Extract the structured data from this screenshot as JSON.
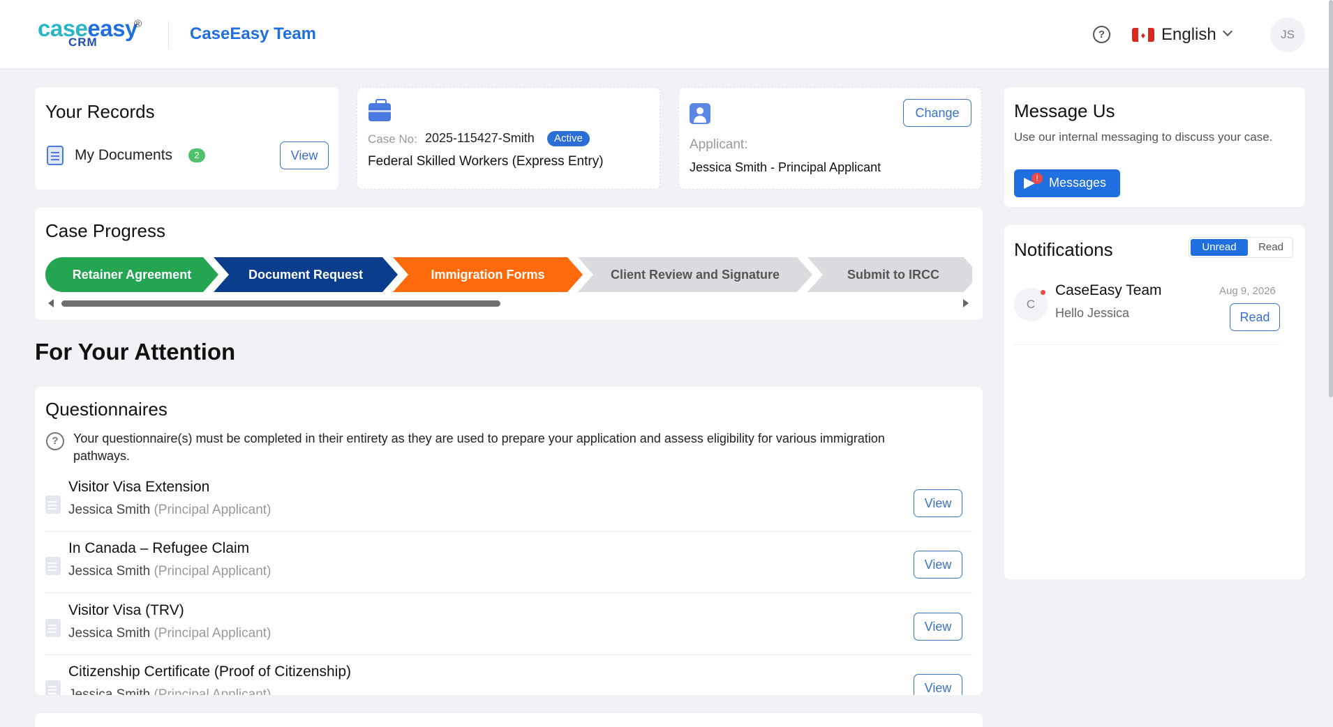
{
  "header": {
    "logo_case": "case",
    "logo_easy": "easy",
    "logo_sub": "CRM",
    "logo_reg": "®",
    "team_name": "CaseEasy Team",
    "help_icon": "?",
    "language": "English",
    "user_initials": "JS"
  },
  "records": {
    "title": "Your Records",
    "my_documents_label": "My Documents",
    "my_documents_count": "2",
    "view_label": "View"
  },
  "case": {
    "case_no_label": "Case No:",
    "case_no": "2025-115427-Smith",
    "status": "Active",
    "program": "Federal Skilled Workers (Express Entry)"
  },
  "applicant": {
    "change_label": "Change",
    "label": "Applicant:",
    "name": "Jessica Smith - Principal Applicant"
  },
  "message": {
    "title": "Message Us",
    "description": "Use our internal messaging to discuss your case.",
    "button_label": "Messages",
    "unread_count": "!"
  },
  "notifications": {
    "title": "Notifications",
    "tab_unread": "Unread",
    "tab_read": "Read",
    "items": [
      {
        "avatar": "C",
        "from": "CaseEasy Team",
        "date": "Aug 9, 2026",
        "message": "Hello Jessica",
        "action": "Read"
      }
    ]
  },
  "progress": {
    "title": "Case Progress",
    "steps": [
      {
        "label": "Retainer Agreement",
        "status": "complete",
        "color": "#23a552"
      },
      {
        "label": "Document Request",
        "status": "complete",
        "color": "#0a3d8c"
      },
      {
        "label": "Immigration Forms",
        "status": "current",
        "color": "#ff6a0a"
      },
      {
        "label": "Client Review and Signature",
        "status": "pending",
        "color": "#d9dbde"
      },
      {
        "label": "Submit to IRCC",
        "status": "pending",
        "color": "#d9dbde"
      }
    ]
  },
  "attention": {
    "title": "For Your Attention"
  },
  "questionnaires": {
    "title": "Questionnaires",
    "info": "Your questionnaire(s) must be completed in their entirety as they are used to prepare your application and assess eligibility for various immigration pathways.",
    "items": [
      {
        "title": "Visitor Visa Extension",
        "person": "Jessica Smith",
        "role": "(Principal Applicant)",
        "action": "View"
      },
      {
        "title": "In Canada – Refugee Claim",
        "person": "Jessica Smith",
        "role": "(Principal Applicant)",
        "action": "View"
      },
      {
        "title": "Visitor Visa (TRV)",
        "person": "Jessica Smith",
        "role": "(Principal Applicant)",
        "action": "View"
      },
      {
        "title": "Citizenship Certificate (Proof of Citizenship)",
        "person": "Jessica Smith",
        "role": "(Principal Applicant)",
        "action": "View"
      }
    ]
  },
  "colors": {
    "brand": "#1f6fe0",
    "brand_teal": "#2bb5c9",
    "active_badge": "#2b6fd6",
    "docs_badge": "#4fc36b"
  }
}
